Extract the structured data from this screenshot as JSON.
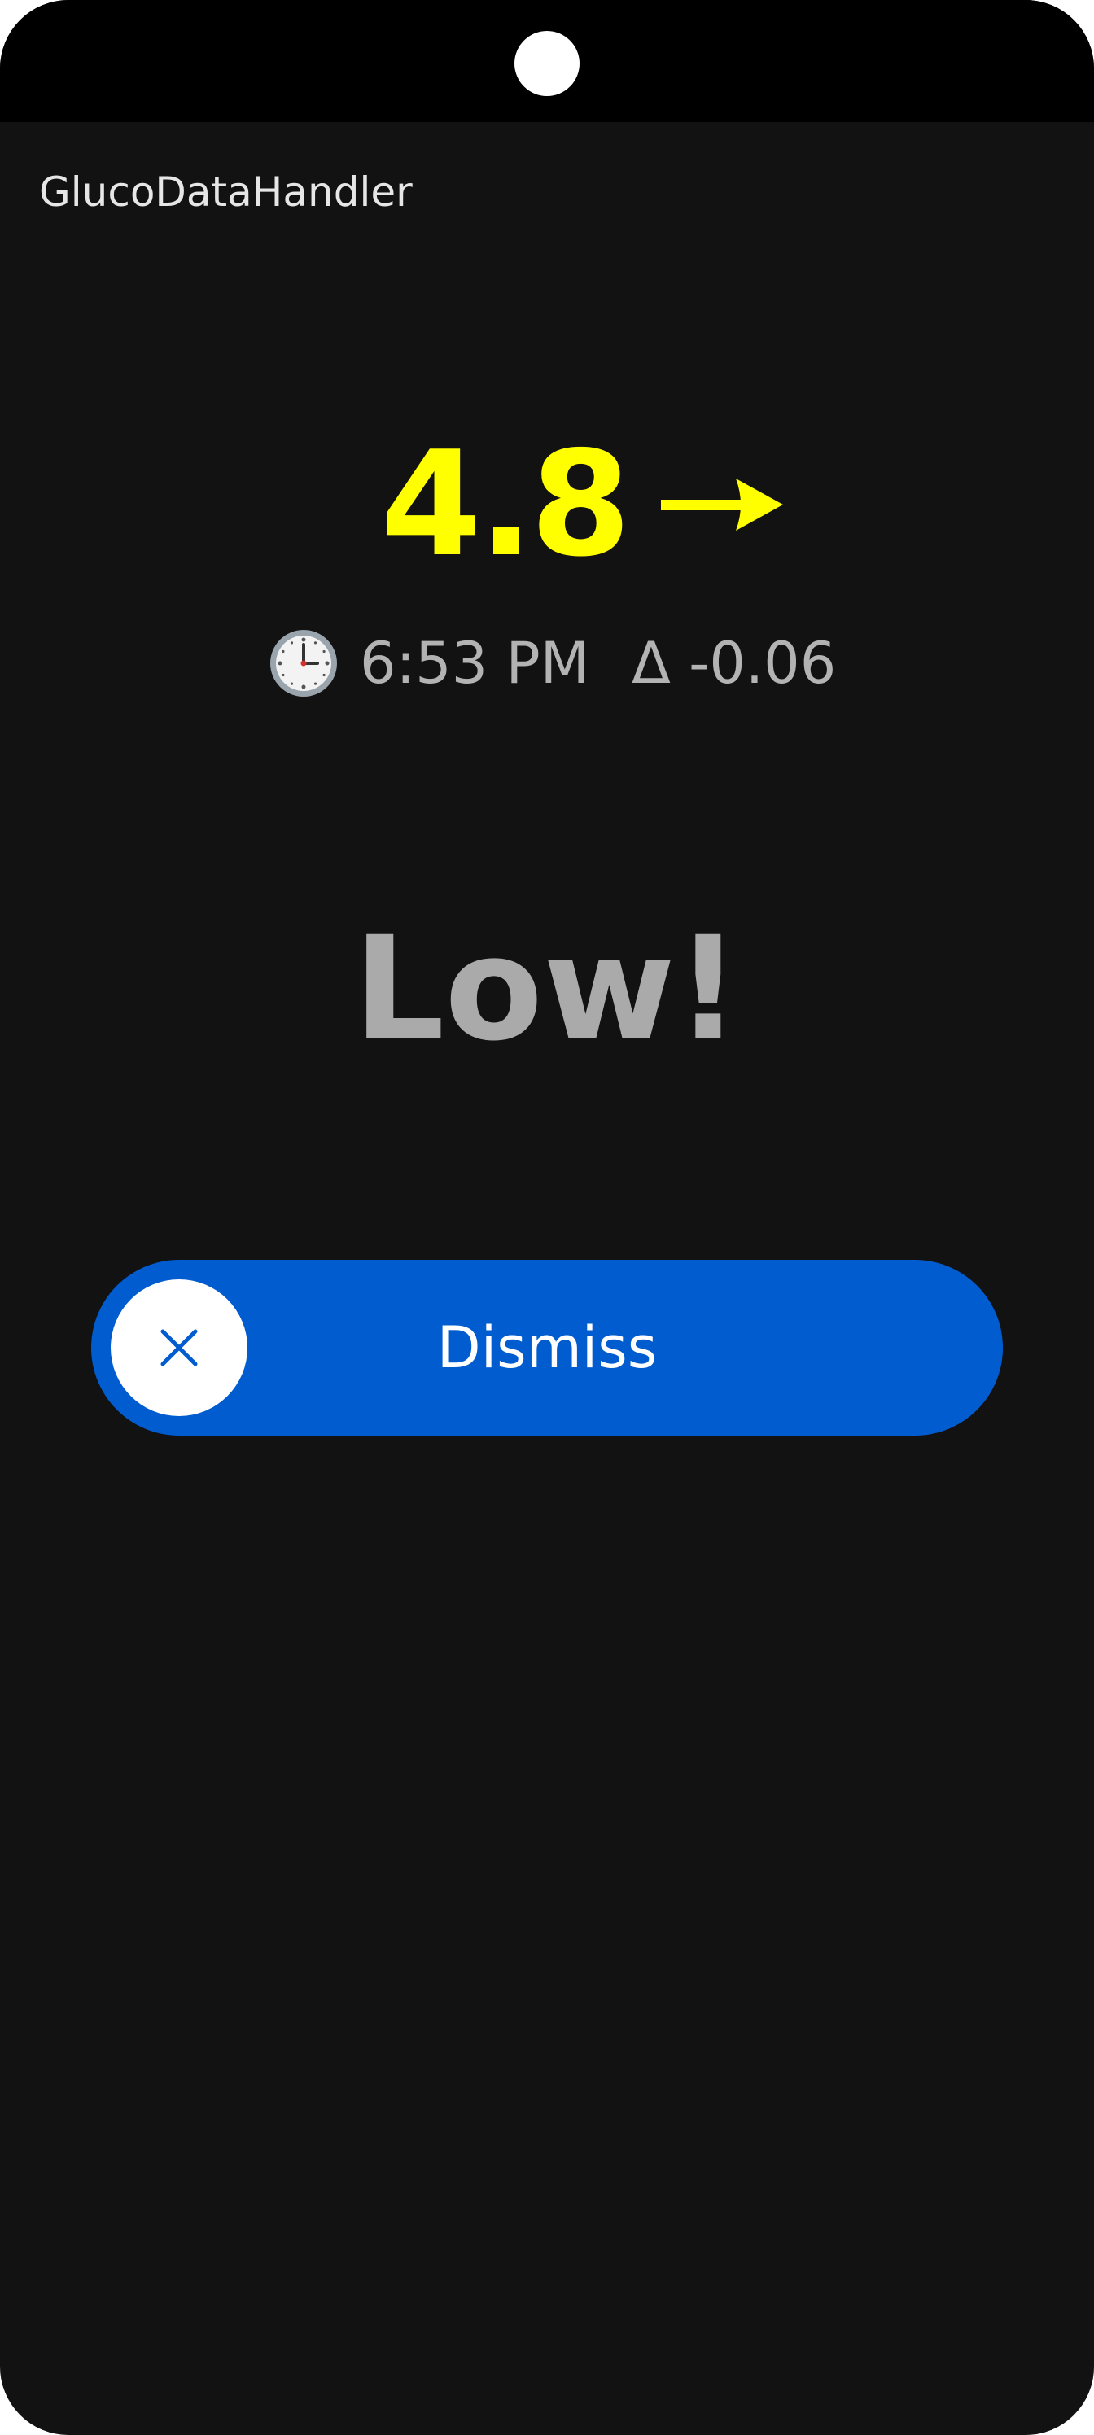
{
  "app": {
    "title": "GlucoDataHandler"
  },
  "reading": {
    "value": "4.8",
    "trend_icon": "arrow-right-icon",
    "time_icon": "clock-icon",
    "time": "6:53 PM",
    "delta": "Δ -0.06"
  },
  "alarm": {
    "label": "Low!"
  },
  "dismiss": {
    "label": "Dismiss",
    "icon": "close-icon"
  },
  "colors": {
    "background": "#121212",
    "status_bar": "#000000",
    "glucose_value": "#ffff00",
    "secondary_text": "#b3b3b3",
    "alarm_text": "#aaaaaa",
    "dismiss_slider": "#005ccf",
    "dismiss_knob": "#ffffff"
  }
}
